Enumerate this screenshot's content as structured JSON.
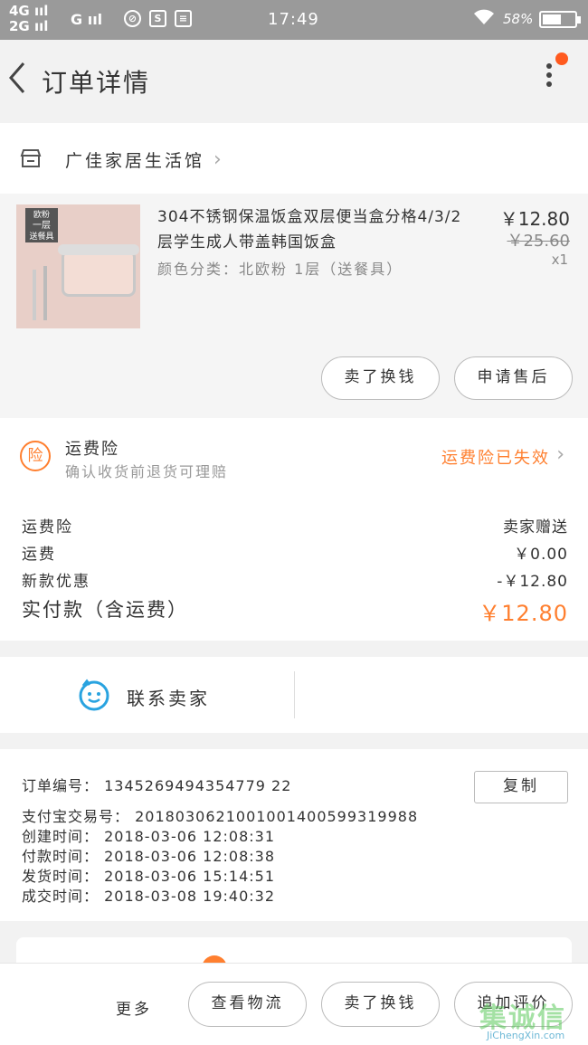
{
  "statusbar": {
    "signal1": "4G ııl",
    "signal2": "2G ııl",
    "signal3": "G ııl",
    "icon1": "⊘",
    "icon2": "S",
    "icon3": "≡",
    "time": "17:49",
    "wifi": "wifi-icon",
    "battery": "58%"
  },
  "nav": {
    "title": "订单详情",
    "has_notification": true,
    "notification_color": "#ff5a1f"
  },
  "shop": {
    "name": "广佳家居生活馆"
  },
  "product": {
    "badge_line1": "欧粉",
    "badge_line2": "一层",
    "badge_line3": "送餐具",
    "title": "304不锈钢保温饭盒双层便当盒分格4/3/2层学生成人带盖韩国饭盒",
    "attr": "颜色分类：北欧粉 1层（送餐具）",
    "price": "￥12.80",
    "original_price": "￥25.60",
    "qty": "x1",
    "buttons": [
      "卖了换钱",
      "申请售后"
    ]
  },
  "insurance": {
    "badge": "险",
    "title": "运费险",
    "subtitle": "确认收货前退货可理赔",
    "status": "运费险已失效",
    "accent": "#ff7f2f"
  },
  "summary": {
    "rows": [
      {
        "label": "运费险",
        "value": "卖家赠送"
      },
      {
        "label": "运费",
        "value": "￥0.00"
      },
      {
        "label": "新款优惠",
        "value": "-￥12.80"
      }
    ],
    "total_label": "实付款（含运费）",
    "total_value": "￥12.80"
  },
  "contact": {
    "label": "联系卖家",
    "icon": "seller-face-icon"
  },
  "order_info": {
    "lines": [
      "订单编号：  1345269494354779 22",
      "支付宝交易号：  2018030621001001400599319988",
      "创建时间：  2018-03-06  12:08:31",
      "付款时间：  2018-03-06  12:08:38",
      "发货时间：  2018-03-06  15:14:51",
      "成交时间：  2018-03-08  19:40:32"
    ],
    "copy_label": "复制"
  },
  "bottombar": {
    "more": "更多",
    "buttons": [
      "查看物流",
      "卖了换钱",
      "追加评价"
    ]
  },
  "watermark": {
    "text": "集诚信",
    "url": "JiChengXin.com"
  }
}
